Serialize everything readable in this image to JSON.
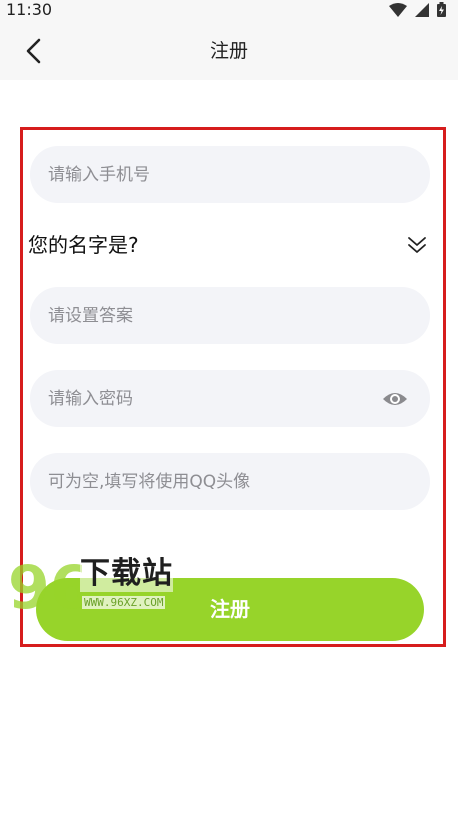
{
  "status_bar": {
    "time": "11:30",
    "icons": [
      "wifi-icon",
      "signal-icon",
      "battery-icon"
    ]
  },
  "nav": {
    "title": "注册",
    "back_icon": "chevron-left-icon"
  },
  "form": {
    "phone_placeholder": "请输入手机号",
    "security_question": "您的名字是?",
    "answer_placeholder": "请设置答案",
    "password_placeholder": "请输入密码",
    "qq_placeholder": "可为空,填写将使用QQ头像",
    "submit_label": "注册"
  },
  "watermark": {
    "number": "96",
    "text": "下载站",
    "url": "WWW.96XZ.COM"
  },
  "colors": {
    "accent": "#97d42a",
    "field_bg": "#f3f4f8",
    "highlight_frame": "#d61d1d",
    "bar_bg": "#f7f7f7"
  }
}
